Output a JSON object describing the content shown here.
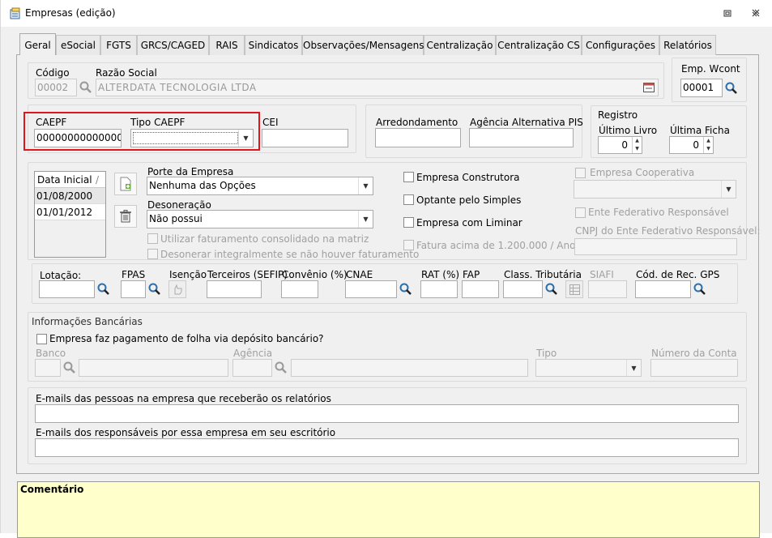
{
  "window": {
    "title": "Empresas (edição)"
  },
  "tabs": [
    "Geral",
    "eSocial",
    "FGTS",
    "GRCS/CAGED",
    "RAIS",
    "Sindicatos",
    "Observações/Mensagens",
    "Centralização",
    "Centralização CS",
    "Configurações",
    "Relatórios"
  ],
  "empresa": {
    "codigo_label": "Código",
    "codigo_value": "00002",
    "razao_label": "Razão Social",
    "razao_value": "ALTERDATA TECNOLOGIA  LTDA",
    "wcont_label": "Emp. Wcont",
    "wcont_value": "00001"
  },
  "caepf": {
    "caepf_label": "CAEPF",
    "caepf_value": "00000000000000",
    "tipo_label": "Tipo CAEPF",
    "tipo_value": "",
    "cei_label": "CEI",
    "cei_value": ""
  },
  "arred": {
    "arred_label": "Arredondamento",
    "agencia_pis_label": "Agência Alternativa PIS"
  },
  "registro": {
    "label": "Registro",
    "ultimo_livro_label": "Último Livro",
    "ultimo_livro_value": "0",
    "ultima_ficha_label": "Última Ficha",
    "ultima_ficha_value": "0"
  },
  "datas": {
    "header": "Data Inicial",
    "rows": [
      "01/08/2000",
      "01/01/2012"
    ]
  },
  "porte": {
    "label": "Porte da Empresa",
    "value": "Nenhuma das Opções"
  },
  "desoneracao": {
    "label": "Desoneração",
    "value": "Não possui"
  },
  "checks_mid": {
    "utilizar": "Utilizar faturamento consolidado na matriz",
    "desonerar": "Desonerar integralmente se não houver faturamento"
  },
  "checks_right": {
    "construtora": "Empresa Construtora",
    "simples": "Optante pelo Simples",
    "liminar": "Empresa com Liminar",
    "fatura": "Fatura acima de 1.200.000 / Ano"
  },
  "cooperativa": {
    "label": "Empresa Cooperativa",
    "ente_label": "Ente Federativo Responsável",
    "cnpj_ente_label": "CNPJ do Ente Federativo Responsável:"
  },
  "row_fiscal": {
    "lotacao": "Lotação:",
    "fpas": "FPAS",
    "isencao": "Isenção",
    "terceiros": "Terceiros (SEFIP)",
    "convenio": "Convênio (%)",
    "cnae": "CNAE",
    "rat": "RAT (%)",
    "fap": "FAP",
    "class_trib": "Class. Tributária",
    "siafi": "SIAFI",
    "cod_gps": "Cód. de Rec. GPS"
  },
  "bancarias": {
    "title": "Informações Bancárias",
    "deposito": "Empresa faz pagamento de folha via depósito bancário?",
    "banco": "Banco",
    "agencia": "Agência",
    "tipo": "Tipo",
    "numero_conta": "Número da Conta"
  },
  "emails": {
    "pessoas_label": "E-mails das pessoas na empresa que receberão os relatórios",
    "responsaveis_label": "E-mails dos responsáveis por essa empresa em seu escritório"
  },
  "comentario": {
    "label": "Comentário"
  },
  "colors": {
    "highlight": "#e0161d",
    "comment_bg": "#ffffcc"
  }
}
